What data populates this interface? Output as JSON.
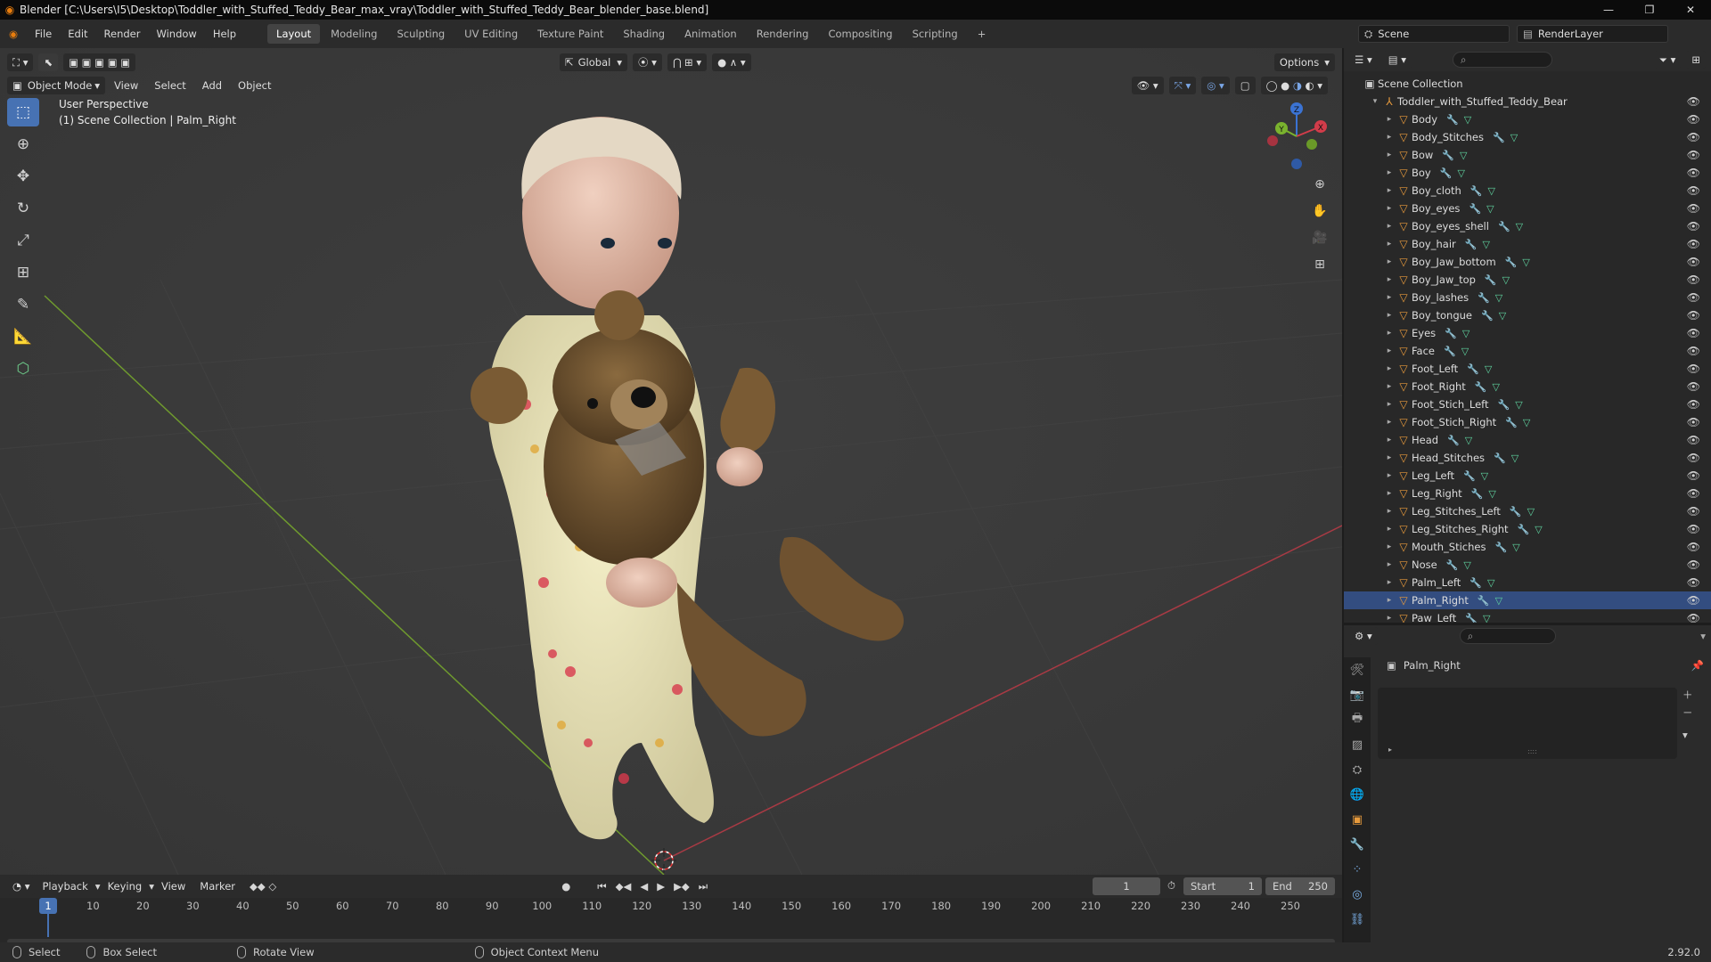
{
  "window": {
    "title": "Blender [C:\\Users\\I5\\Desktop\\Toddler_with_Stuffed_Teddy_Bear_max_vray\\Toddler_with_Stuffed_Teddy_Bear_blender_base.blend]",
    "minimize": "—",
    "maximize": "❐",
    "close": "✕"
  },
  "menu": [
    "File",
    "Edit",
    "Render",
    "Window",
    "Help"
  ],
  "workspaces": [
    "Layout",
    "Modeling",
    "Sculpting",
    "UV Editing",
    "Texture Paint",
    "Shading",
    "Animation",
    "Rendering",
    "Compositing",
    "Scripting"
  ],
  "workspace_add": "+",
  "scene": {
    "name": "Scene",
    "render_layer": "RenderLayer"
  },
  "viewport": {
    "mode": "Object Mode",
    "menus": [
      "View",
      "Select",
      "Add",
      "Object"
    ],
    "transform": "Global",
    "options": "Options",
    "perspective": "User Perspective",
    "collection_info": "(1) Scene Collection | Palm_Right",
    "gizmo": {
      "x": "X",
      "y": "Y",
      "z": "Z"
    }
  },
  "outliner": {
    "search_placeholder": "",
    "root": "Scene Collection",
    "collection": "Toddler_with_Stuffed_Teddy_Bear",
    "objects": [
      "Body",
      "Body_Stitches",
      "Bow",
      "Boy",
      "Boy_cloth",
      "Boy_eyes",
      "Boy_eyes_shell",
      "Boy_hair",
      "Boy_Jaw_bottom",
      "Boy_Jaw_top",
      "Boy_lashes",
      "Boy_tongue",
      "Eyes",
      "Face",
      "Foot_Left",
      "Foot_Right",
      "Foot_Stich_Left",
      "Foot_Stich_Right",
      "Head",
      "Head_Stitches",
      "Leg_Left",
      "Leg_Right",
      "Leg_Stitches_Left",
      "Leg_Stitches_Right",
      "Mouth_Stiches",
      "Nose",
      "Palm_Left",
      "Palm_Right",
      "Paw_Left"
    ],
    "selected": "Palm_Right"
  },
  "properties": {
    "object_name": "Palm_Right"
  },
  "timeline": {
    "menus": [
      "Playback",
      "Keying",
      "View",
      "Marker"
    ],
    "current_frame": "1",
    "start_label": "Start",
    "start": "1",
    "end_label": "End",
    "end": "250",
    "ticks": [
      "10",
      "20",
      "30",
      "40",
      "50",
      "60",
      "70",
      "80",
      "90",
      "100",
      "110",
      "120",
      "130",
      "140",
      "150",
      "160",
      "170",
      "180",
      "190",
      "200",
      "210",
      "220",
      "230",
      "240",
      "250"
    ],
    "playhead": "1"
  },
  "statusbar": {
    "select": "Select",
    "box_select": "Box Select",
    "rotate": "Rotate View",
    "context": "Object Context Menu",
    "version": "2.92.0"
  }
}
